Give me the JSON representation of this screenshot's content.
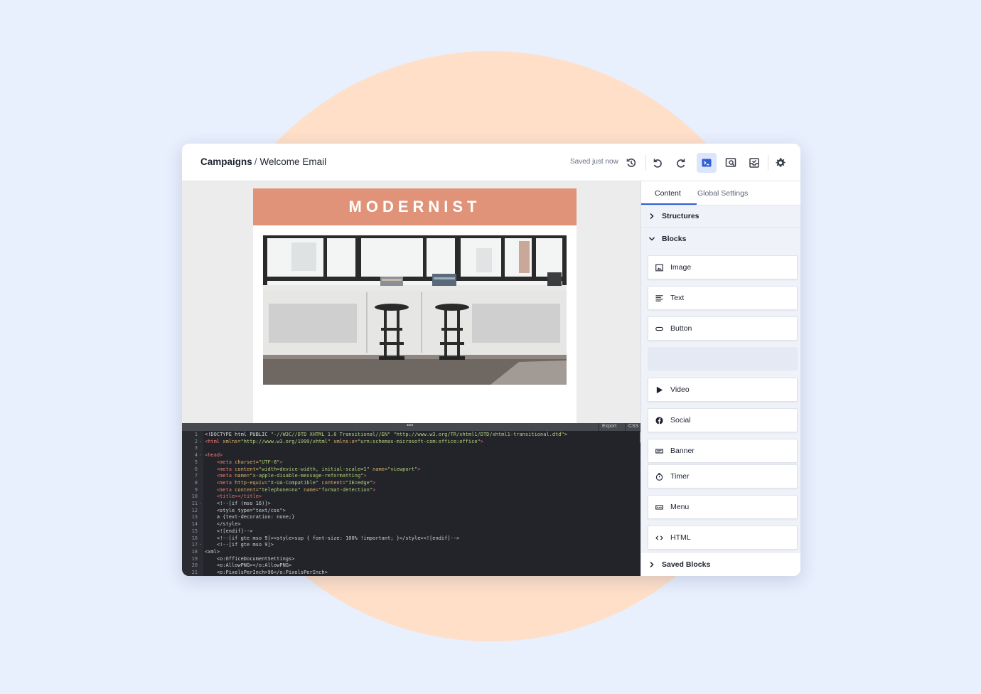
{
  "breadcrumb": {
    "parent": "Campaigns",
    "separator": "/",
    "current": "Welcome Email"
  },
  "toolbar": {
    "status": "Saved just now",
    "icons": [
      "history-icon",
      "undo-icon",
      "redo-icon",
      "code-editor-icon",
      "preview-icon",
      "send-test-icon",
      "settings-icon"
    ],
    "active_icon": "code-editor-icon",
    "accent_color": "#2f5fd6"
  },
  "email": {
    "brand": "MODERNIST",
    "brand_color": "#e09378"
  },
  "editor": {
    "tabs": [
      "Export",
      "CSS"
    ],
    "lines": [
      {
        "n": "1",
        "f": "",
        "p": [
          [
            "txt",
            "<!DOCTYPE html PUBLIC "
          ],
          [
            "str",
            "\"-//W3C//DTD XHTML 1.0 Transitional//EN\""
          ],
          [
            "txt",
            " "
          ],
          [
            "str",
            "\"http://www.w3.org/TR/xhtml1/DTD/xhtml1-transitional.dtd\""
          ],
          [
            "txt",
            ">"
          ]
        ]
      },
      {
        "n": "2",
        "f": "-",
        "p": [
          [
            "tag",
            "<html "
          ],
          [
            "attr",
            "xmlns="
          ],
          [
            "str",
            "\"http://www.w3.org/1999/xhtml\""
          ],
          [
            "txt",
            " "
          ],
          [
            "attr",
            "xmlns:o="
          ],
          [
            "str",
            "\"urn:schemas-microsoft-com:office:office\""
          ],
          [
            "tag",
            ">"
          ]
        ]
      },
      {
        "n": "3",
        "f": "",
        "p": []
      },
      {
        "n": "4",
        "f": "-",
        "p": [
          [
            "tag",
            "<head>"
          ]
        ]
      },
      {
        "n": "5",
        "f": "",
        "p": [
          [
            "txt",
            "    "
          ],
          [
            "tag",
            "<meta "
          ],
          [
            "attr",
            "charset="
          ],
          [
            "str",
            "\"UTF-8\""
          ],
          [
            "tag",
            ">"
          ]
        ]
      },
      {
        "n": "6",
        "f": "",
        "p": [
          [
            "txt",
            "    "
          ],
          [
            "tag",
            "<meta "
          ],
          [
            "attr",
            "content="
          ],
          [
            "str",
            "\"width=device-width, initial-scale=1\""
          ],
          [
            "txt",
            " "
          ],
          [
            "attr",
            "name="
          ],
          [
            "str",
            "\"viewport\""
          ],
          [
            "tag",
            ">"
          ]
        ]
      },
      {
        "n": "7",
        "f": "",
        "p": [
          [
            "txt",
            "    "
          ],
          [
            "tag",
            "<meta "
          ],
          [
            "attr",
            "name="
          ],
          [
            "str",
            "\"x-apple-disable-message-reformatting\""
          ],
          [
            "tag",
            ">"
          ]
        ]
      },
      {
        "n": "8",
        "f": "",
        "p": [
          [
            "txt",
            "    "
          ],
          [
            "tag",
            "<meta "
          ],
          [
            "attr",
            "http-equiv="
          ],
          [
            "str",
            "\"X-UA-Compatible\""
          ],
          [
            "txt",
            " "
          ],
          [
            "attr",
            "content="
          ],
          [
            "str",
            "\"IE=edge\""
          ],
          [
            "tag",
            ">"
          ]
        ]
      },
      {
        "n": "9",
        "f": "",
        "p": [
          [
            "txt",
            "    "
          ],
          [
            "tag",
            "<meta "
          ],
          [
            "attr",
            "content="
          ],
          [
            "str",
            "\"telephone=no\""
          ],
          [
            "txt",
            " "
          ],
          [
            "attr",
            "name="
          ],
          [
            "str",
            "\"format-detection\""
          ],
          [
            "tag",
            ">"
          ]
        ]
      },
      {
        "n": "10",
        "f": "",
        "p": [
          [
            "txt",
            "    "
          ],
          [
            "tag",
            "<title></title>"
          ]
        ]
      },
      {
        "n": "11",
        "f": "-",
        "p": [
          [
            "cmt",
            "    <!--[if (mso 16)]>"
          ]
        ]
      },
      {
        "n": "12",
        "f": "",
        "p": [
          [
            "cmt",
            "    <style type=\"text/css\">"
          ]
        ]
      },
      {
        "n": "13",
        "f": "",
        "p": [
          [
            "cmt",
            "    a {text-decoration: none;}"
          ]
        ]
      },
      {
        "n": "14",
        "f": "",
        "p": [
          [
            "cmt",
            "    </style>"
          ]
        ]
      },
      {
        "n": "15",
        "f": "",
        "p": [
          [
            "cmt",
            "    <![endif]-->"
          ]
        ]
      },
      {
        "n": "16",
        "f": "",
        "p": [
          [
            "cmt",
            "    <!--[if gte mso 9]><style>sup { font-size: 100% !important; }</style><![endif]-->"
          ]
        ]
      },
      {
        "n": "17",
        "f": "-",
        "p": [
          [
            "cmt",
            "    <!--[if gte mso 9]>"
          ]
        ]
      },
      {
        "n": "18",
        "f": "",
        "p": [
          [
            "cmt",
            "<xml>"
          ]
        ]
      },
      {
        "n": "19",
        "f": "",
        "p": [
          [
            "cmt",
            "    <o:OfficeDocumentSettings>"
          ]
        ]
      },
      {
        "n": "20",
        "f": "",
        "p": [
          [
            "cmt",
            "    <o:AllowPNG></o:AllowPNG>"
          ]
        ]
      },
      {
        "n": "21",
        "f": "",
        "p": [
          [
            "cmt",
            "    <o:PixelsPerInch>96</o:PixelsPerInch>"
          ]
        ]
      }
    ]
  },
  "panel": {
    "tabs": [
      "Content",
      "Global Settings"
    ],
    "active_tab": "Content",
    "sections": {
      "structures": "Structures",
      "blocks": "Blocks",
      "saved_blocks": "Saved Blocks"
    },
    "blocks": [
      {
        "label": "Image",
        "icon": "image-icon"
      },
      {
        "label": "Text",
        "icon": "text-icon"
      },
      {
        "label": "Button",
        "icon": "button-icon"
      },
      {
        "label": "",
        "icon": ""
      },
      {
        "label": "Video",
        "icon": "video-icon"
      },
      {
        "label": "Social",
        "icon": "social-icon"
      },
      {
        "label": "Banner",
        "icon": "banner-icon"
      },
      {
        "label": "Timer",
        "icon": "timer-icon"
      },
      {
        "label": "Menu",
        "icon": "menu-icon"
      },
      {
        "label": "HTML",
        "icon": "html-icon"
      }
    ]
  }
}
